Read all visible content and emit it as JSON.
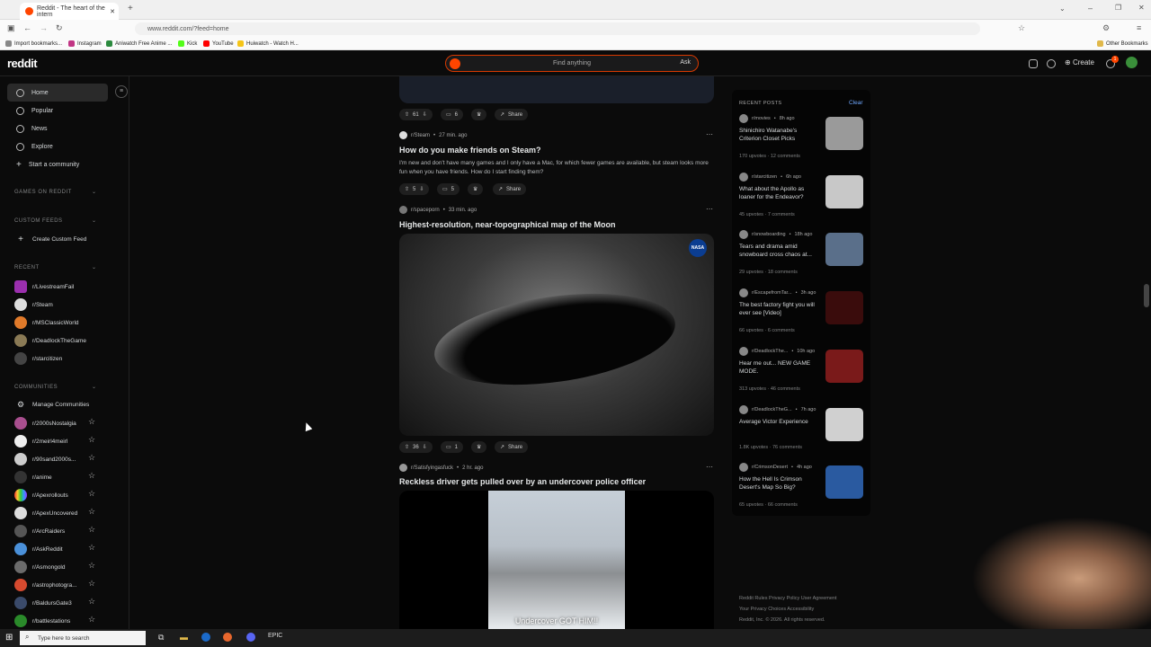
{
  "browser": {
    "tab_title": "Reddit - The heart of the intern",
    "url": "www.reddit.com/?feed=home",
    "bookmarks": [
      "Import bookmarks...",
      "Instagram",
      "Aniwatch Free Anime ...",
      "Kick",
      "YouTube",
      "Huiwatch - Watch H..."
    ],
    "other_bookmarks": "Other Bookmarks"
  },
  "header": {
    "logo": "reddit",
    "search_placeholder": "Find anything",
    "ask_label": "Ask",
    "create_label": "Create",
    "notif_count": "1"
  },
  "sidebar": {
    "nav": [
      "Home",
      "Popular",
      "News",
      "Explore",
      "Start a community"
    ],
    "games_heading": "GAMES ON REDDIT",
    "custom_heading": "CUSTOM FEEDS",
    "create_feed": "Create Custom Feed",
    "recent_heading": "RECENT",
    "recent": [
      "r/LivestreamFail",
      "r/Steam",
      "r/MSClassicWorld",
      "r/DeadlockTheGame",
      "r/starcitizen"
    ],
    "communities_heading": "COMMUNITIES",
    "manage": "Manage Communities",
    "communities": [
      "r/2000sNostalgia",
      "r/2meirl4meirl",
      "r/90sand2000s...",
      "r/anime",
      "r/Apexrollouts",
      "r/ApexUncovered",
      "r/ArcRaiders",
      "r/AskReddit",
      "r/Asmongold",
      "r/astrophotogra...",
      "r/BaldursGate3",
      "r/battlestations"
    ]
  },
  "feed": {
    "top_actions": {
      "votes": "61",
      "comments": "6",
      "share": "Share"
    },
    "post1": {
      "sub": "r/Steam",
      "time": "27 min. ago",
      "title": "How do you make friends on Steam?",
      "body": "I'm new and don't have many games and I only have a Mac, for which fewer games are available, but steam looks more fun when you have friends. How do I start finding them?",
      "votes": "5",
      "comments": "5",
      "share": "Share"
    },
    "post2": {
      "sub": "r/spaceporn",
      "time": "33 min. ago",
      "title": "Highest-resolution, near-topographical map of the Moon",
      "badge": "NASA",
      "votes": "36",
      "comments": "1",
      "share": "Share"
    },
    "post3": {
      "sub": "r/Satisfyingasfuck",
      "time": "2 hr. ago",
      "title": "Reckless driver gets pulled over by an undercover police officer",
      "caption": "Undercover GOT HIM!!"
    }
  },
  "recent_posts": {
    "heading": "RECENT POSTS",
    "clear": "Clear",
    "items": [
      {
        "sub": "r/movies",
        "time": "8h ago",
        "title": "Shinichiro Watanabe's Criterion Closet Picks",
        "upvotes": "170 upvotes",
        "comments": "12 comments"
      },
      {
        "sub": "r/starcitizen",
        "time": "6h ago",
        "title": "What about the Apollo as loaner for the Endeavor?",
        "upvotes": "45 upvotes",
        "comments": "7 comments"
      },
      {
        "sub": "r/snowboarding",
        "time": "18h ago",
        "title": "Tears and drama amid snowboard cross chaos at...",
        "upvotes": "29 upvotes",
        "comments": "18 comments"
      },
      {
        "sub": "r/EscapefromTar...",
        "time": "3h ago",
        "title": "The best factory fight you will ever see [Video]",
        "upvotes": "66 upvotes",
        "comments": "6 comments"
      },
      {
        "sub": "r/DeadlockThe...",
        "time": "10h ago",
        "title": "Hear me out... NEW GAME MODE.",
        "upvotes": "313 upvotes",
        "comments": "46 comments"
      },
      {
        "sub": "r/DeadlockTheG...",
        "time": "7h ago",
        "title": "Average Victor Experience",
        "upvotes": "1.8K upvotes",
        "comments": "76 comments"
      },
      {
        "sub": "r/CrimsonDesert",
        "time": "4h ago",
        "title": "How the Hell Is Crimson Desert's Map So Big?",
        "upvotes": "65 upvotes",
        "comments": "66 comments"
      }
    ]
  },
  "footer": {
    "line1": "Reddit Rules  Privacy Policy  User Agreement",
    "line2": "Your Privacy Choices  Accessibility",
    "line3": "Reddit, Inc. © 2026. All rights reserved."
  },
  "taskbar": {
    "search": "Type here to search"
  }
}
